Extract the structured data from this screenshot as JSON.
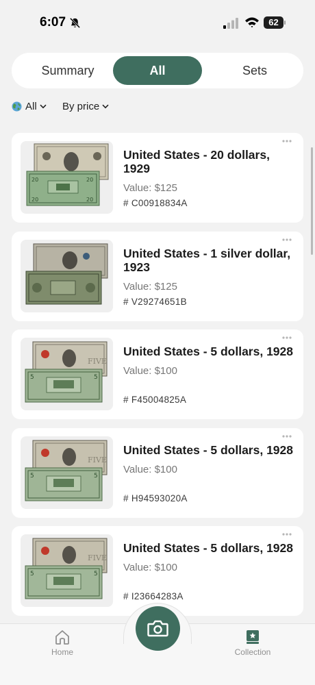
{
  "status_bar": {
    "time": "6:07",
    "battery": "62"
  },
  "tabs": [
    {
      "label": "Summary",
      "active": false
    },
    {
      "label": "All",
      "active": true
    },
    {
      "label": "Sets",
      "active": false
    }
  ],
  "filters": {
    "region": "All",
    "sort": "By price"
  },
  "items": [
    {
      "title": "United States - 20 dollars, 1929",
      "value": "Value: $125",
      "serial": "# C00918834A"
    },
    {
      "title": "United States - 1 silver dollar, 1923",
      "value": "Value: $125",
      "serial": "# V29274651B"
    },
    {
      "title": "United States - 5 dollars, 1928",
      "value": "Value: $100",
      "serial": "# F45004825A"
    },
    {
      "title": "United States - 5 dollars, 1928",
      "value": "Value: $100",
      "serial": "# H94593020A"
    },
    {
      "title": "United States - 5 dollars, 1928",
      "value": "Value: $100",
      "serial": "# I23664283A"
    }
  ],
  "bottom_nav": {
    "home_label": "Home",
    "collection_label": "Collection"
  },
  "colors": {
    "accent": "#3f6e5f",
    "background": "#f2f2f2",
    "card": "#ffffff"
  },
  "icons": [
    "bell-slash-icon",
    "signal-icon",
    "wifi-icon",
    "globe-icon",
    "chevron-down-icon",
    "more-icon",
    "camera-icon",
    "home-icon",
    "collection-icon"
  ]
}
